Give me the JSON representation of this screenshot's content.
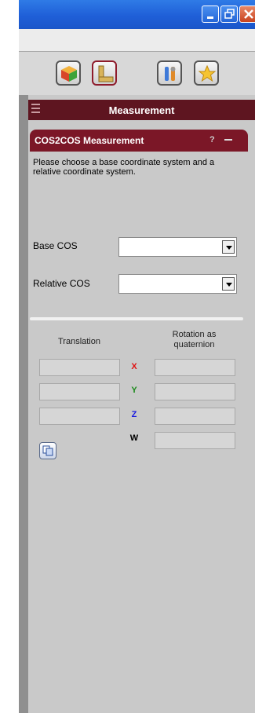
{
  "window": {
    "minimize_icon": "minimize-icon",
    "restore_icon": "restore-icon",
    "close_icon": "close-icon"
  },
  "toolbar": {
    "tools": [
      {
        "icon": "cube-icon"
      },
      {
        "icon": "ruler-icon",
        "active": true
      },
      {
        "icon": "tools-icon"
      },
      {
        "icon": "star-icon"
      }
    ]
  },
  "panel": {
    "title": "Measurement"
  },
  "section": {
    "title": "COS2COS Measurement",
    "help": "?",
    "description": "Please choose a base coordinate system and a relative coordinate system."
  },
  "fields": {
    "base_label": "Base COS",
    "base_value": "",
    "relative_label": "Relative COS",
    "relative_value": ""
  },
  "result": {
    "translation_header": "Translation",
    "rotation_header": "Rotation as quaternion",
    "axes": [
      {
        "label": "X",
        "color": "#e01010"
      },
      {
        "label": "Y",
        "color": "#1b8a1b"
      },
      {
        "label": "Z",
        "color": "#1a1ae0"
      },
      {
        "label": "W",
        "color": "#000000"
      }
    ]
  },
  "colors": {
    "panel_header": "#5e1520",
    "section_header": "#7b1727",
    "panel_bg": "#c9c9c9"
  }
}
